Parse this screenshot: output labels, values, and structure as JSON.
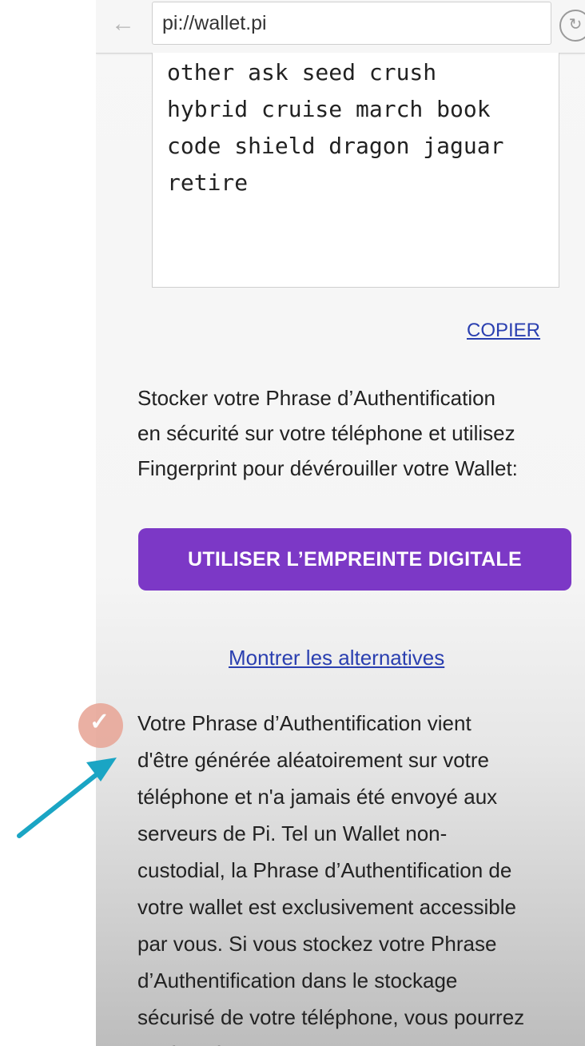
{
  "browser": {
    "back_icon": "←",
    "url": "pi://wallet.pi",
    "reload_icon": "↻"
  },
  "phrase": {
    "lines": [
      "other ask seed crush",
      "hybrid cruise march book",
      "code shield dragon jaguar",
      "retire"
    ],
    "copy_label": "COPIER"
  },
  "instruction": {
    "lines": [
      "Stocker votre Phrase d’Authentification",
      "en sécurité sur votre téléphone et utilisez",
      "Fingerprint pour dévérouiller votre Wallet:"
    ]
  },
  "fingerprint_button": {
    "label": "UTILISER L’EMPREINTE DIGITALE",
    "color": "#7c38c6"
  },
  "alternatives_link": {
    "label": "Montrer les alternatives"
  },
  "info": {
    "lines": [
      "Votre Phrase d’Authentification vient",
      "d'être générée aléatoirement sur votre",
      "téléphone et n'a jamais été envoyé aux",
      "serveurs de Pi. Tel un Wallet non-",
      "custodial, la Phrase d’Authentification de",
      "votre wallet est exclusivement accessible",
      "par vous. Si vous stockez votre Phrase",
      "d’Authentification dans le stockage",
      "sécurisé de votre téléphone, vous pourrez",
      "la récupérer plus tard avec votre accord"
    ]
  },
  "annotation": {
    "check_icon": "✓",
    "arrow_color": "#1aa5c4"
  }
}
